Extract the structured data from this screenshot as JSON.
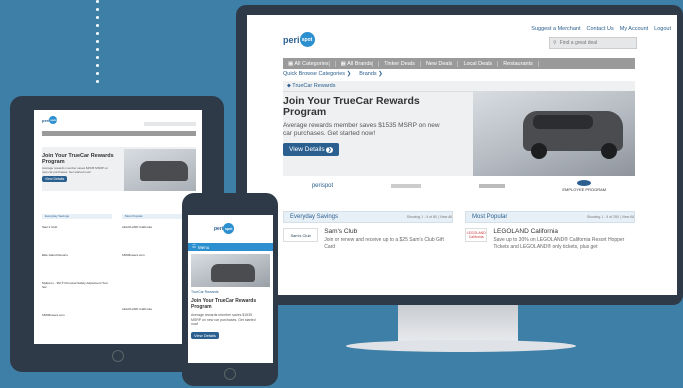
{
  "site": {
    "logo_left": "peri",
    "logo_right": "spot"
  },
  "desktop": {
    "top_links": [
      "Suggest a Merchant",
      "Contact Us",
      "My Account",
      "Logout"
    ],
    "search_placeholder": "Find a great deal",
    "nav": [
      "All Categories",
      "All Brands",
      "Tinker Deals",
      "New Deals",
      "Local Deals",
      "Restaurants"
    ],
    "quick_browse": "Quick Browse Categories",
    "brands": "Brands",
    "breadcrumb": "TrueCar Rewards",
    "hero_title": "Join Your TrueCar Rewards Program",
    "hero_text": "Average rewards member saves $1535 MSRP on new car purchases. Get started now!",
    "hero_button": "View Details",
    "partners": [
      "perispot",
      "",
      "",
      "EMPLOYEE PROGRAM"
    ],
    "section1": {
      "title": "Everyday Savings",
      "count": "Showing 1 - 9 of 80 | View All"
    },
    "section2": {
      "title": "Most Popular",
      "count": "Showing 1 - 9 of 250 | View All"
    },
    "deal1": {
      "logo": "Sam's Club",
      "title": "Sam's Club",
      "text": "Join or renew and receive up to a $25 Sam's Club Gift Card"
    },
    "deal2": {
      "logo": "LEGOLAND California",
      "title": "LEGOLAND California",
      "text": "Save up to 30% on LEGOLAND® California Resort Hopper Tickets and LEGOLAND® only tickets, plus get"
    }
  },
  "tablet": {
    "breadcrumb": "TrueCar Rewards",
    "hero_title": "Join Your TrueCar Rewards Program",
    "hero_text": "Average rewards member saves $1535 MSRP on new car purchases. Get started now!",
    "hero_button": "View Details",
    "section1": "Everyday Savings",
    "section2": "Most Popular",
    "left_deals": [
      "Sam's Club",
      "Elite Island Resorts",
      "MyEvron - 3M ® Personal Safety Adjustment Tool Set",
      "1800flowers.com"
    ],
    "right_deals": [
      "LEGOLAND California",
      "1800flowers.com",
      "LEGOLAND California"
    ]
  },
  "phone": {
    "menu": "Menu",
    "breadcrumb": "TrueCar Rewards",
    "hero_title": "Join Your TrueCar Rewards Program",
    "hero_text": "Average rewards member saves $1535 MSRP on new car purchases. Get started now!",
    "hero_button": "View Details"
  }
}
